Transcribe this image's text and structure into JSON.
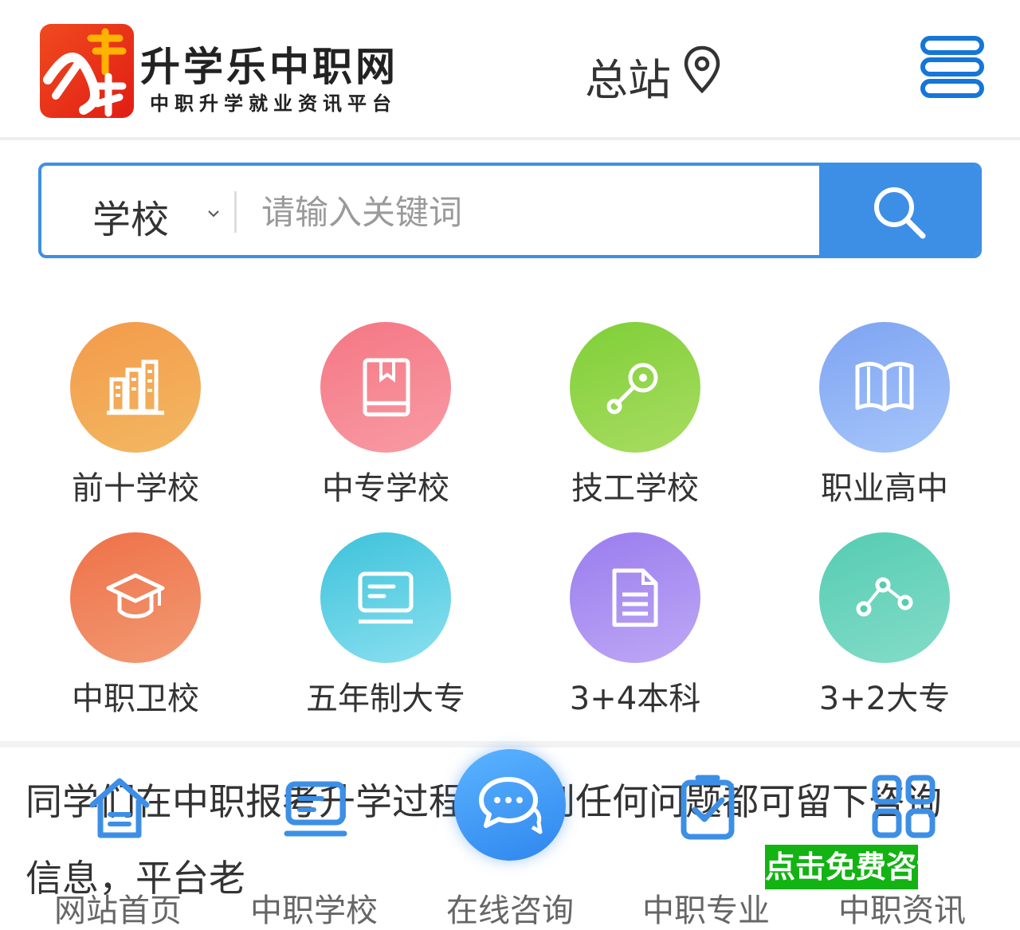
{
  "header": {
    "logo_mark": "升学乐",
    "site_name": "升学乐中职网",
    "tagline": "中职升学就业资讯平台",
    "station": "总站",
    "icons": {
      "location": "map-pin-icon",
      "menu": "hamburger-menu-icon"
    }
  },
  "search": {
    "type_label": "学校",
    "placeholder": "请输入关键词",
    "value": "",
    "button_icon": "search-icon",
    "accent": "#3d8fe6"
  },
  "categories": [
    {
      "label": "前十学校",
      "icon": "buildings-icon",
      "color": "#f2a64d"
    },
    {
      "label": "中专学校",
      "icon": "book-icon",
      "color": "#f68892"
    },
    {
      "label": "技工学校",
      "icon": "key-icon",
      "color": "#8ed34a"
    },
    {
      "label": "职业高中",
      "icon": "open-book-icon",
      "color": "#8bb3f5"
    },
    {
      "label": "中职卫校",
      "icon": "graduation-cap-icon",
      "color": "#f07d57"
    },
    {
      "label": "五年制大专",
      "icon": "monitor-icon",
      "color": "#4fc7df"
    },
    {
      "label": "3+4本科",
      "icon": "document-icon",
      "color": "#a78ef0"
    },
    {
      "label": "3+2大专",
      "icon": "nodes-icon",
      "color": "#6dd3bd"
    }
  ],
  "notice": {
    "line1": "同学们在中职报考升学过程中遇到任何问题都可留下咨询",
    "line2": "信息，平台老"
  },
  "bottom_nav": {
    "items": [
      {
        "label": "网站首页",
        "icon": "home-icon"
      },
      {
        "label": "中职学校",
        "icon": "school-screen-icon"
      },
      {
        "label": "在线咨询",
        "icon": "chat-bubbles-icon"
      },
      {
        "label": "中职专业",
        "icon": "clipboard-check-icon"
      },
      {
        "label": "中职资讯",
        "icon": "grid-icon"
      }
    ],
    "free_consult": "点击免费咨询",
    "active_color": "#3d8fe6",
    "consult_color": "#12b312"
  }
}
